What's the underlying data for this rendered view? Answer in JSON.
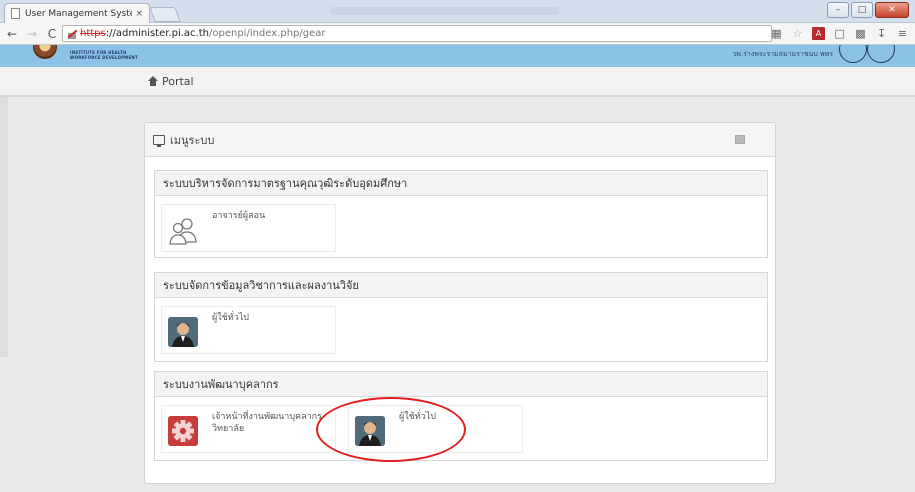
{
  "browser": {
    "tab_title": "User Management System",
    "tab_close": "×",
    "url_scheme": "https",
    "url_host": "://administer.pi.ac.th",
    "url_path": "/openpi/index.php/gear",
    "back_icon": "←",
    "forward_icon": "→",
    "reload_icon": "C",
    "menu_icon": "≡",
    "window_controls": [
      "–",
      "□",
      "✕"
    ]
  },
  "site_header": {
    "logo_line1": "INSTITUTE FOR HEALTH",
    "logo_line2": "WORKFORCE DEVELOPMENT",
    "right_text": "วพ.ร่างพระรามสมามราชนบ พพร"
  },
  "nav": {
    "portal_label": "Portal"
  },
  "panel": {
    "title": "เมนูระบบ"
  },
  "groups": [
    {
      "title": "ระบบบริหารจัดการมาตรฐานคุณวุฒิระดับอุดมศึกษา",
      "cards": [
        {
          "label": "อาจารย์ผู้สอน",
          "icon": "people-outline-icon"
        }
      ]
    },
    {
      "title": "ระบบจัดการข้อมูลวิชาการและผลงานวิจัย",
      "cards": [
        {
          "label": "ผู้ใช้ทั่วไป",
          "icon": "user-avatar-icon"
        }
      ]
    },
    {
      "title": "ระบบงานพัฒนาบุคลากร",
      "cards": [
        {
          "label": "เจ้าหน้าที่งานพัฒนาบุคลากร วิทยาลัย",
          "icon": "gear-icon"
        },
        {
          "label": "ผู้ใช้ทั่วไป",
          "icon": "user-avatar-icon"
        }
      ]
    }
  ],
  "colors": {
    "header_bg": "#8cc2e6",
    "annotation": "#e11d1d",
    "gear_tile": "#c93c3c",
    "avatar_tile": "#3d5a6c"
  }
}
